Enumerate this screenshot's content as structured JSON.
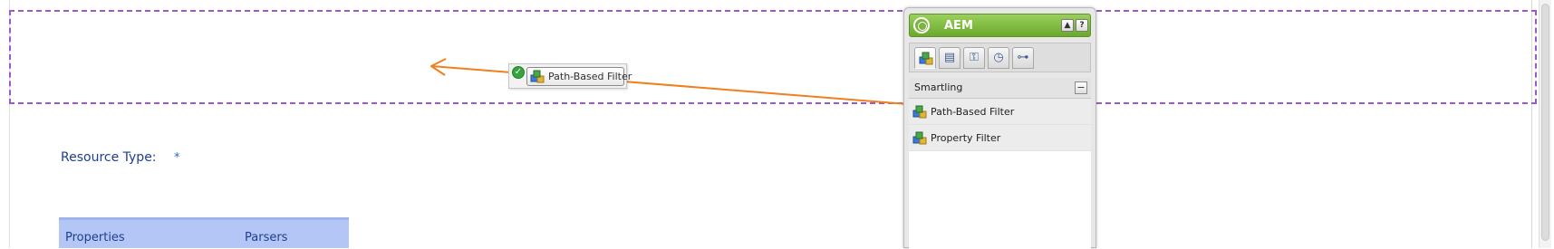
{
  "page": {
    "resource_type_label": "Resource Type:",
    "required_marker": "*",
    "table": {
      "columns": [
        "Properties",
        "Parsers"
      ]
    },
    "colors": {
      "drop_zone_border": "#9b59c9",
      "drag_arrow": "#f07f1e",
      "table_header": "#b4c6f5",
      "label_text": "#1f3f8f"
    }
  },
  "drag": {
    "label": "Path-Based Filter",
    "status_icon": "check-icon",
    "item_icon": "component-icon"
  },
  "sidekick": {
    "title": "AEM",
    "logo_icon": "aem-logo-icon",
    "header_buttons": [
      "collapse-icon",
      "help-icon"
    ],
    "help_label": "?",
    "collapse_label": "▲",
    "tabs": [
      {
        "icon": "components-icon",
        "glyph": "▣",
        "active": true
      },
      {
        "icon": "page-icon",
        "glyph": "▤",
        "active": false
      },
      {
        "icon": "lock-icon",
        "glyph": "⚿",
        "active": false
      },
      {
        "icon": "clock-icon",
        "glyph": "◷",
        "active": false
      },
      {
        "icon": "workflow-icon",
        "glyph": "⊶",
        "active": false
      }
    ],
    "group": {
      "label": "Smartling",
      "toggle": "−"
    },
    "items": [
      {
        "label": "Path-Based Filter",
        "icon": "component-icon"
      },
      {
        "label": "Property Filter",
        "icon": "component-icon"
      }
    ]
  }
}
